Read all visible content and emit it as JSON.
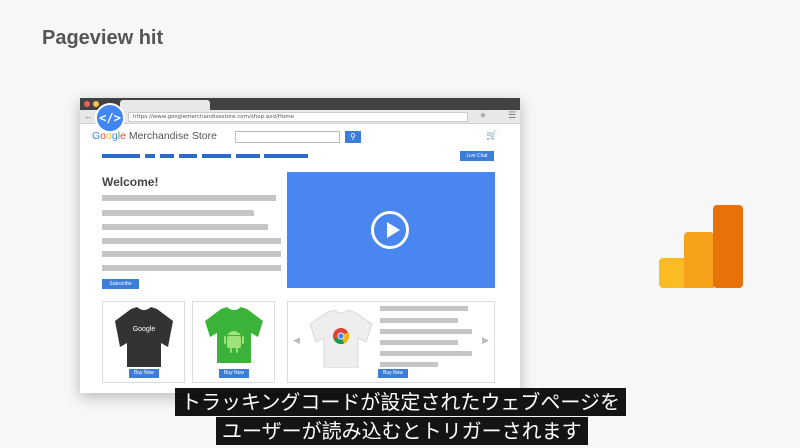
{
  "slide": {
    "title": "Pageview hit"
  },
  "browser": {
    "url": "https://www.googlemerchandisestore.com/shop.axd/Home",
    "code_badge": "</>",
    "store_name": "Merchandise Store",
    "logo_letters": [
      "G",
      "o",
      "o",
      "g",
      "l",
      "e"
    ],
    "live_chat": "Live Chat",
    "welcome": "Welcome!",
    "subscribe": "Subscribe",
    "buy_now": "Buy Now",
    "shirt_text": "Google"
  },
  "colors": {
    "accent": "#3b7dd8",
    "video": "#4a86f0",
    "ga_yellow": "#f9bd23",
    "ga_orange": "#e8710a"
  },
  "icons": [
    "back-arrow-icon",
    "star-icon",
    "menu-icon",
    "search-icon",
    "cart-icon",
    "play-icon",
    "code-icon",
    "android-icon",
    "chrome-icon",
    "analytics-logo"
  ],
  "subtitles": {
    "line1": "トラッキングコードが設定されたウェブページを",
    "line2": "ユーザーが読み込むとトリガーされます"
  }
}
